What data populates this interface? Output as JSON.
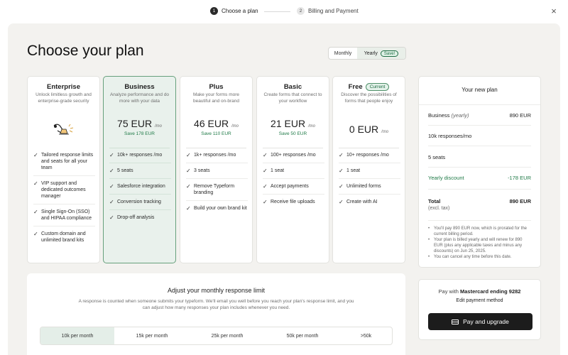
{
  "stepper": {
    "step1": {
      "num": "1",
      "label": "Choose a plan"
    },
    "step2": {
      "num": "2",
      "label": "Billing and Payment"
    },
    "close": "×"
  },
  "page": {
    "title": "Choose your plan"
  },
  "billing": {
    "monthly": "Monthly",
    "yearly": "Yearly",
    "save": "Save!",
    "selected": "Yearly"
  },
  "plans": [
    {
      "name": "Enterprise",
      "desc": "Unlock limitless growth and enterprise-grade security",
      "features": [
        "Tailored response limits and seats for all your team",
        "VIP support and dedicated outcomes manager",
        "Single Sign-On (SSO) and HIPAA compliance",
        "Custom domain and unlimited brand kits"
      ]
    },
    {
      "name": "Business",
      "desc": "Analyze performance and do more with your data",
      "price": "75 EUR",
      "unit": "/mo",
      "save": "Save 178 EUR",
      "features": [
        "10k+ responses /mo",
        "5 seats",
        "Salesforce integration",
        "Conversion tracking",
        "Drop-off analysis"
      ]
    },
    {
      "name": "Plus",
      "desc": "Make your forms more beautiful and on-brand",
      "price": "46 EUR",
      "unit": "/mo",
      "save": "Save 110 EUR",
      "features": [
        "1k+ responses /mo",
        "3 seats",
        "Remove Typeform branding",
        "Build your own brand kit"
      ]
    },
    {
      "name": "Basic",
      "desc": "Create forms that connect to your workflow",
      "price": "21 EUR",
      "unit": "/mo",
      "save": "Save 50 EUR",
      "features": [
        "100+ responses /mo",
        "1 seat",
        "Accept payments",
        "Receive file uploads"
      ]
    },
    {
      "name": "Free",
      "badge": "Current",
      "desc": "Discover the possibilities of forms that people enjoy",
      "price": "0 EUR",
      "unit": "/mo",
      "features": [
        "10+ responses /mo",
        "1 seat",
        "Unlimited forms",
        "Create with AI"
      ]
    }
  ],
  "summary": {
    "title": "Your new plan",
    "plan_label": "Business",
    "plan_period": "(yearly)",
    "plan_price": "890 EUR",
    "responses": "10k responses/mo",
    "seats": "5 seats",
    "discount_label": "Yearly discount",
    "discount_value": "-178 EUR",
    "total_label": "Total",
    "total_sub": "(excl. tax)",
    "total_value": "890 EUR",
    "notes": [
      "You'll pay 890 EUR now, which is prorated for the current billing period.",
      "Your plan is billed yearly and will renew for 890 EUR (plus any applicable taxes and minus any discounts) on Jun 25, 2025.",
      "You can cancel any time before this date."
    ]
  },
  "payment": {
    "pay_with_prefix": "Pay with",
    "card": "Mastercard ending 9282",
    "edit": "Edit payment method",
    "button": "Pay and upgrade"
  },
  "limit": {
    "title": "Adjust your monthly response limit",
    "desc": "A response is counted when someone submits your typeform. We'll email you well before you reach your plan's response limit, and you can adjust how many responses your plan includes whenever you need.",
    "options": [
      "10k per month",
      "15k per month",
      "25k per month",
      "50k per month",
      ">50k"
    ],
    "selected": "10k per month"
  },
  "colors": {
    "accent_green": "#1f7a47",
    "selected_card_bg": "#e9f1ec",
    "panel_bg": "#f3f2ef",
    "button_bg": "#1c1c1c"
  }
}
